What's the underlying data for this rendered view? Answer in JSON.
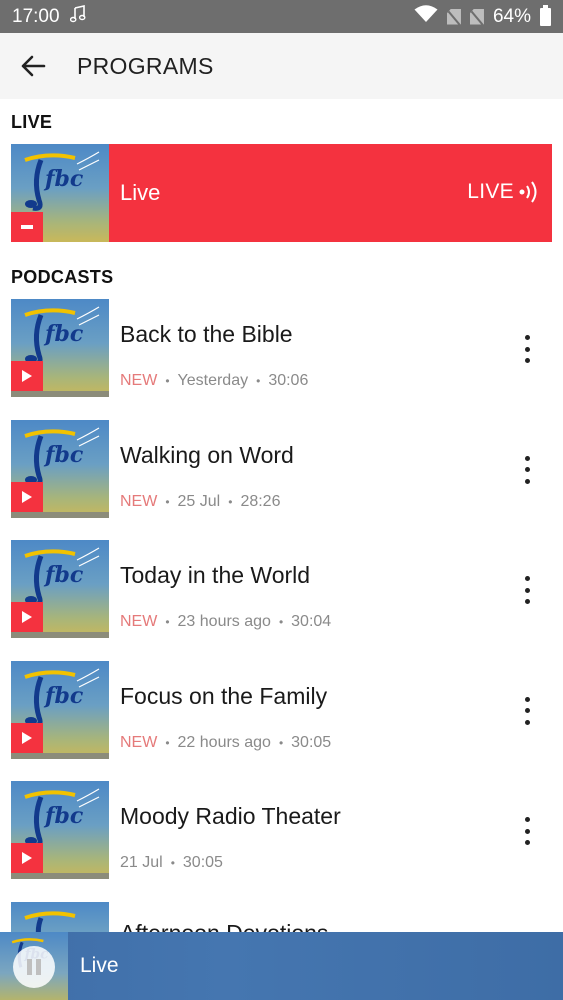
{
  "status_bar": {
    "time": "17:00",
    "battery": "64%",
    "icons": [
      "music-note-icon",
      "wifi-icon",
      "no-sim-icon",
      "no-sim-icon",
      "battery-icon"
    ]
  },
  "app_bar": {
    "title": "PROGRAMS",
    "back_icon": "arrow-left-icon"
  },
  "live_section": {
    "heading": "LIVE",
    "item": {
      "label": "Live",
      "badge": "LIVE",
      "badge_icon": "broadcast-icon",
      "thumb_text": "fbc",
      "color": "#f4323f"
    }
  },
  "podcasts_section": {
    "heading": "PODCASTS",
    "items": [
      {
        "title": "Back to the Bible",
        "new_label": "NEW",
        "date": "Yesterday",
        "duration": "30:06"
      },
      {
        "title": "Walking on Word",
        "new_label": "NEW",
        "date": "25 Jul",
        "duration": "28:26"
      },
      {
        "title": "Today in the World",
        "new_label": "NEW",
        "date": "23 hours ago",
        "duration": "30:04"
      },
      {
        "title": "Focus on the Family",
        "new_label": "NEW",
        "date": "22 hours ago",
        "duration": "30:05"
      },
      {
        "title": "Moody Radio Theater",
        "new_label": "",
        "date": "21 Jul",
        "duration": "30:05"
      }
    ],
    "partial_item_title": "Afternoon Devotions"
  },
  "mini_player": {
    "label": "Live",
    "icon": "pause-icon"
  },
  "colors": {
    "accent": "#f4323f",
    "player_bar": "#4576b0",
    "new_label": "#e57a7a"
  }
}
